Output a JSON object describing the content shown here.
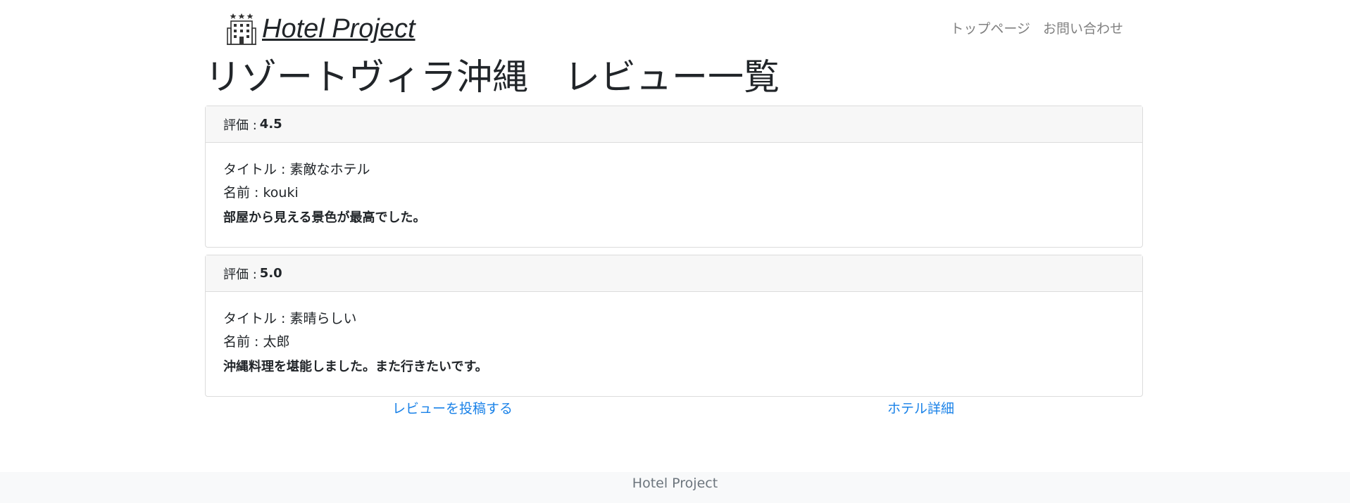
{
  "navbar": {
    "brand_icon": "hotel-building-icon",
    "brand_text": "Hotel Project",
    "links": [
      "トップページ",
      "お問い合わせ"
    ]
  },
  "page": {
    "title": "リゾートヴィラ沖縄　レビュー一覧"
  },
  "reviews": [
    {
      "rating_label": "評価 :",
      "rating_value": "4.5",
      "title_line": "タイトル : 素敵なホテル",
      "name_line": "名前 : kouki",
      "comment": "部屋から見える景色が最高でした。"
    },
    {
      "rating_label": "評価 :",
      "rating_value": "5.0",
      "title_line": "タイトル : 素晴らしい",
      "name_line": "名前 : 太郎",
      "comment": "沖縄料理を堪能しました。また行きたいです。"
    }
  ],
  "actions": {
    "post_review": "レビューを投稿する",
    "hotel_detail": "ホテル詳細"
  },
  "footer": {
    "text": "Hotel Project"
  },
  "colors": {
    "link": "#1a82e8",
    "nav_link": "#808080",
    "card_header_bg": "#f7f7f7",
    "footer_bg": "#f8f9fa"
  }
}
